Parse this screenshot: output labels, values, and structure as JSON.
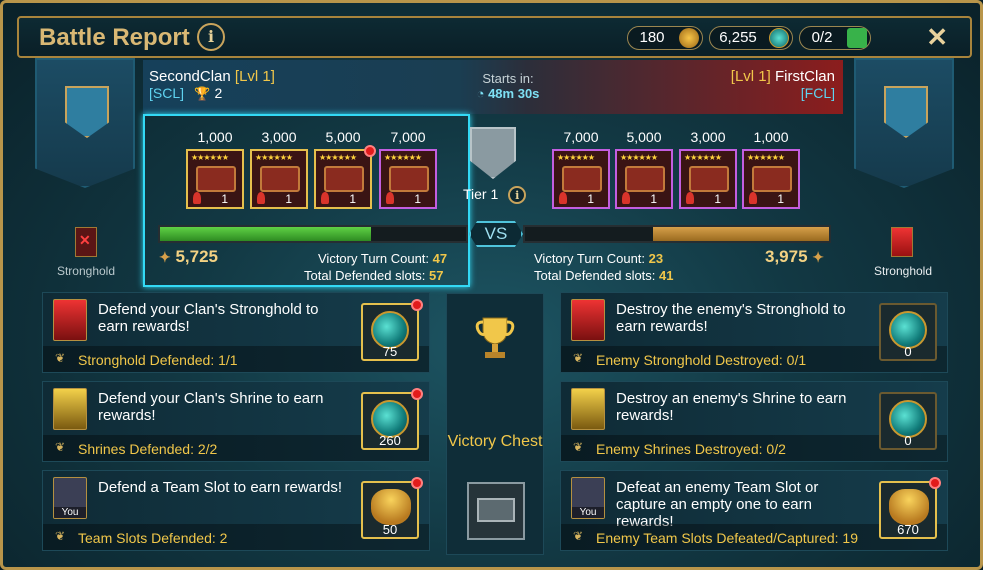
{
  "header": {
    "title": "Battle Report",
    "resources": [
      {
        "value": "180",
        "icon": "gold-bag-icon"
      },
      {
        "value": "6,255",
        "icon": "gem-orb-icon"
      },
      {
        "value": "0/2",
        "icon": "ticket-icon"
      }
    ]
  },
  "left_clan": {
    "name": "SecondClan",
    "level": "[Lvl 1]",
    "tag": "[SCL]",
    "trophies": "2",
    "score": "5,725",
    "victory_turn_label": "Victory Turn Count:",
    "victory_turn": "47",
    "defended_label": "Total Defended slots:",
    "defended": "57",
    "stronghold_label": "Stronghold"
  },
  "right_clan": {
    "name": "FirstClan",
    "level": "[Lvl 1]",
    "tag": "[FCL]",
    "score": "3,975",
    "victory_turn_label": "Victory Turn Count:",
    "victory_turn": "23",
    "defended_label": "Total Defended slots:",
    "defended": "41",
    "stronghold_label": "Stronghold"
  },
  "timer": {
    "label": "Starts in:",
    "value": "48m 30s"
  },
  "tier": {
    "label": "Tier 1"
  },
  "vs": "VS",
  "left_chests": [
    {
      "threshold": "1,000",
      "count": "1",
      "stars": "★★★★★★",
      "reached": true,
      "notify": false
    },
    {
      "threshold": "3,000",
      "count": "1",
      "stars": "★★★★★★",
      "reached": true,
      "notify": false
    },
    {
      "threshold": "5,000",
      "count": "1",
      "stars": "★★★★★★",
      "reached": true,
      "notify": true
    },
    {
      "threshold": "7,000",
      "count": "1",
      "stars": "★★★★★★",
      "reached": false,
      "notify": false
    }
  ],
  "right_chests": [
    {
      "threshold": "7,000",
      "count": "1",
      "stars": "★★★★★★",
      "reached": false
    },
    {
      "threshold": "5,000",
      "count": "1",
      "stars": "★★★★★★",
      "reached": false
    },
    {
      "threshold": "3,000",
      "count": "1",
      "stars": "★★★★★★",
      "reached": false
    },
    {
      "threshold": "1,000",
      "count": "1",
      "stars": "★★★★★★",
      "reached": false
    }
  ],
  "progress": {
    "left_fill_fraction": 0.69,
    "right_fill_fraction": 0.58
  },
  "missions_left": [
    {
      "text": "Defend your Clan's Stronghold to earn rewards!",
      "status": "Stronghold Defended: 1/1",
      "reward": "75",
      "reward_type": "orb",
      "icon": "stronghold-icon",
      "notify": true
    },
    {
      "text": "Defend your Clan's Shrine to earn rewards!",
      "status": "Shrines Defended: 2/2",
      "reward": "260",
      "reward_type": "orb",
      "icon": "shrine-icon",
      "notify": true
    },
    {
      "text": "Defend a Team Slot to earn rewards!",
      "status": "Team Slots Defended: 2",
      "reward": "50",
      "reward_type": "bag",
      "icon": "avatar-icon",
      "avatar_label": "You",
      "notify": true
    }
  ],
  "missions_right": [
    {
      "text": "Destroy the enemy's Stronghold to earn rewards!",
      "status": "Enemy Stronghold Destroyed: 0/1",
      "reward": "0",
      "reward_type": "orb",
      "icon": "stronghold-icon",
      "notify": false
    },
    {
      "text": "Destroy an enemy's Shrine to earn rewards!",
      "status": "Enemy Shrines Destroyed: 0/2",
      "reward": "0",
      "reward_type": "orb",
      "icon": "shrine-icon",
      "notify": false
    },
    {
      "text": "Defeat an enemy Team Slot or capture an empty one to earn rewards!",
      "status": "Enemy Team Slots Defeated/Captured: 19",
      "reward": "670",
      "reward_type": "bag",
      "icon": "avatar-icon",
      "avatar_label": "You",
      "notify": true
    }
  ],
  "victory_chest": {
    "label": "Victory Chest"
  },
  "colors": {
    "gold": "#f1c74a",
    "cyan": "#33d9f5",
    "green": "#4caf34",
    "orange": "#c9892e",
    "red": "#8c1d1d"
  }
}
